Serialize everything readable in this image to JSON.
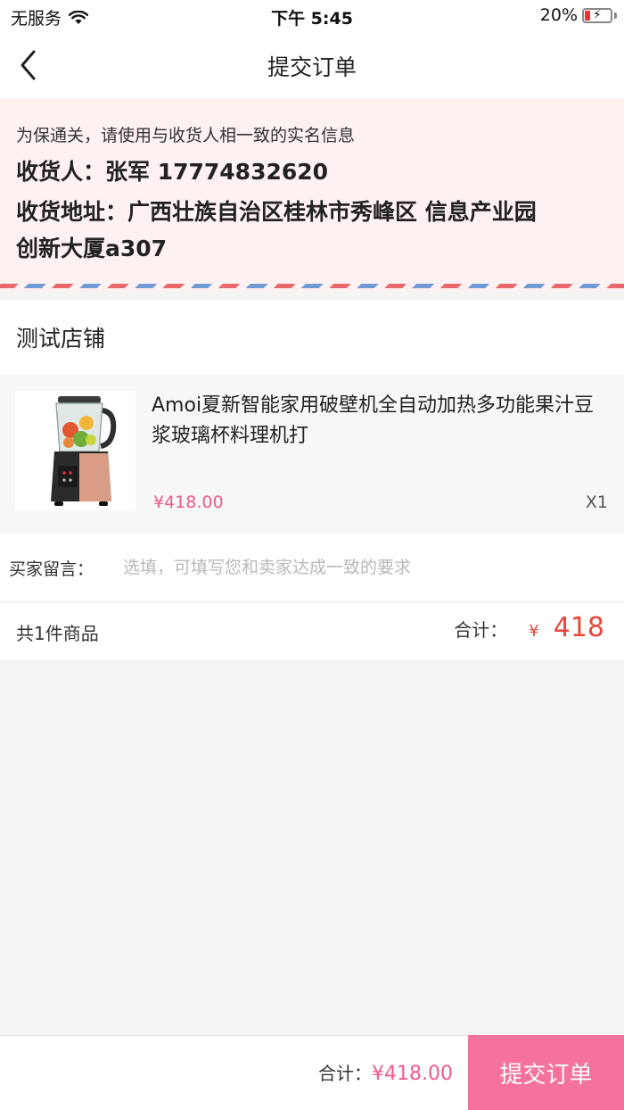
{
  "status_bar": {
    "carrier": "无服务",
    "time": "下午 5:45",
    "battery": "20%",
    "battery_level": 0.2
  },
  "nav": {
    "title": "提交订单",
    "back_icon": "chevron-left-icon"
  },
  "address": {
    "notice": "为保通关，请使用与收货人相一致的实名信息",
    "recipient": "收货人：张军 17774832620",
    "address_line1": "收货地址：广西壮族自治区桂林市秀峰区 信息产业园",
    "address_line2": "创新大厦a307",
    "stripe_colors": [
      "#e9686c",
      "#6f9ad6"
    ]
  },
  "shop": {
    "name": "测试店铺"
  },
  "product": {
    "title": "Amoi夏新智能家用破壁机全自动加热多功能果汁豆浆玻璃杯料理机打",
    "price": "¥418.00",
    "quantity": "X1",
    "image_icon": "blender-image"
  },
  "message": {
    "label": "买家留言：",
    "placeholder": "选填，可填写您和卖家达成一致的要求",
    "value": ""
  },
  "summary": {
    "count": "共1件商品",
    "total_label": "合计：",
    "currency": "¥",
    "total": "418"
  },
  "bottom_bar": {
    "total_label": "合计：",
    "total": "¥418.00",
    "submit_label": "提交订单"
  },
  "colors": {
    "accent_pink": "#f4729c",
    "price_pink": "#ef5a8a",
    "total_red": "#e8473a",
    "address_bg": "#fdf1f1"
  }
}
